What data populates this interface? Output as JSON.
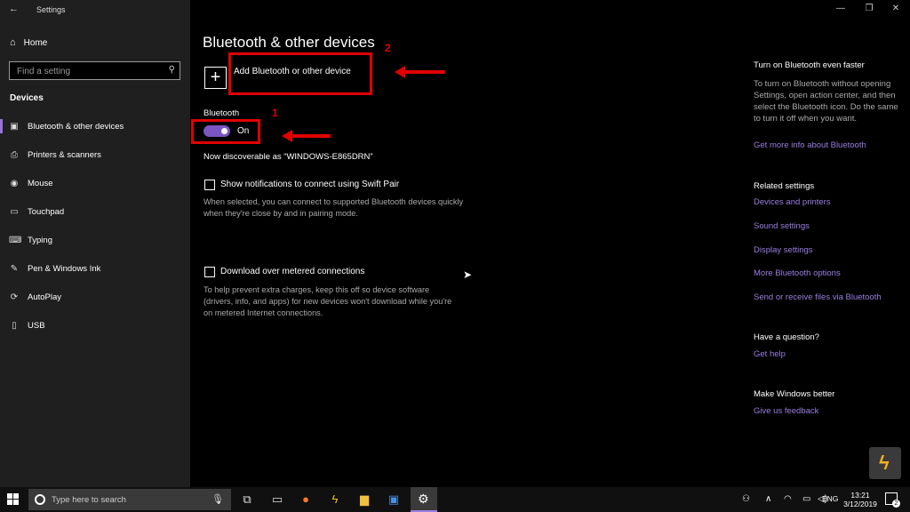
{
  "window": {
    "title": "Settings",
    "back_icon": "back-arrow-icon",
    "minimize": "—",
    "maximize": "❐",
    "close": "✕"
  },
  "sidebar": {
    "home_label": "Home",
    "search_placeholder": "Find a setting",
    "section_header": "Devices",
    "items": [
      {
        "label": "Bluetooth & other devices",
        "icon": "▣",
        "active": true
      },
      {
        "label": "Printers & scanners",
        "icon": "⎙"
      },
      {
        "label": "Mouse",
        "icon": "◉"
      },
      {
        "label": "Touchpad",
        "icon": "▭"
      },
      {
        "label": "Typing",
        "icon": "⌨"
      },
      {
        "label": "Pen & Windows Ink",
        "icon": "✎"
      },
      {
        "label": "AutoPlay",
        "icon": "⟳"
      },
      {
        "label": "USB",
        "icon": "▯"
      }
    ]
  },
  "main": {
    "title": "Bluetooth & other devices",
    "add_device_label": "Add Bluetooth or other device",
    "bluetooth_label": "Bluetooth",
    "bluetooth_state": "On",
    "discoverable_text": "Now discoverable as “WINDOWS-E865DRN”",
    "swift_pair_label": "Show notifications to connect using Swift Pair",
    "swift_pair_desc": "When selected, you can connect to supported Bluetooth devices quickly when they're close by and in pairing mode.",
    "metered_label": "Download over metered connections",
    "metered_desc": "To help prevent extra charges, keep this off so device software (drivers, info, and apps) for new devices won't download while you're on metered Internet connections."
  },
  "annotations": {
    "num1": "1",
    "num2": "2",
    "color": "#e00000"
  },
  "right_pane": {
    "faster_heading": "Turn on Bluetooth even faster",
    "faster_text": "To turn on Bluetooth without opening Settings, open action center, and then select the Bluetooth icon. Do the same to turn it off when you want.",
    "faster_link": "Get more info about Bluetooth",
    "related_heading": "Related settings",
    "related_links": [
      "Devices and printers",
      "Sound settings",
      "Display settings",
      "More Bluetooth options",
      "Send or receive files via Bluetooth"
    ],
    "question_heading": "Have a question?",
    "question_link": "Get help",
    "better_heading": "Make Windows better",
    "better_link": "Give us feedback"
  },
  "taskbar": {
    "search_placeholder": "Type here to search",
    "language": "ENG",
    "time": "13:21",
    "date": "3/12/2019",
    "notification_count": "2"
  },
  "colors": {
    "accent": "#7b55c2",
    "link": "#9a7fe0",
    "sidebar_bg": "#1f1f1f"
  }
}
